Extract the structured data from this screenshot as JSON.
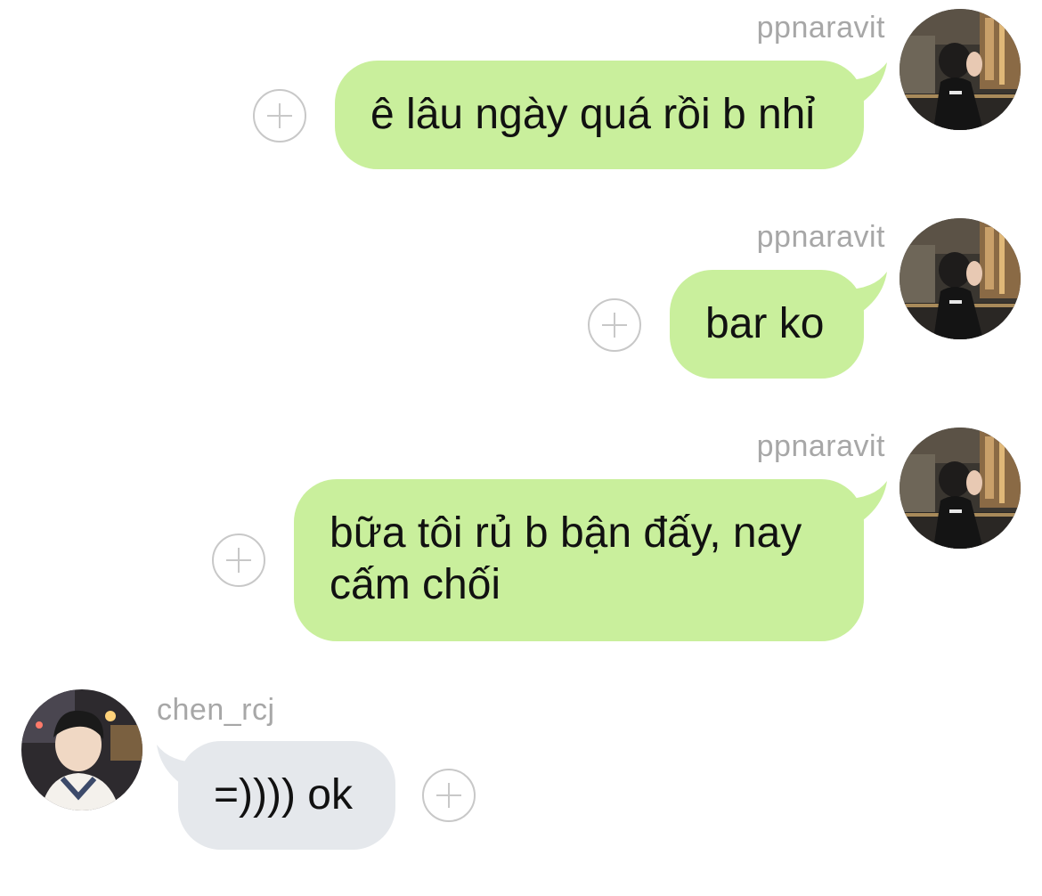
{
  "colors": {
    "outgoing_bubble": "#c9ef9c",
    "incoming_bubble": "#e5e8ec",
    "username_text": "#a7a7a7",
    "icon_gray": "#c8c8c8"
  },
  "messages": [
    {
      "direction": "outgoing",
      "username": "ppnaravit",
      "text": "ê lâu ngày quá rồi b nhỉ",
      "avatar_icon": "user-avatar-icon",
      "action_icon": "add-reaction-icon"
    },
    {
      "direction": "outgoing",
      "username": "ppnaravit",
      "text": "bar ko",
      "avatar_icon": "user-avatar-icon",
      "action_icon": "add-reaction-icon"
    },
    {
      "direction": "outgoing",
      "username": "ppnaravit",
      "text_lines": [
        "bữa tôi rủ b bận đấy, nay",
        "cấm chối"
      ],
      "avatar_icon": "user-avatar-icon",
      "action_icon": "add-reaction-icon"
    },
    {
      "direction": "incoming",
      "username": "chen_rcj",
      "text": "=)))) ok",
      "avatar_icon": "user-avatar-icon",
      "action_icon": "add-reaction-icon"
    }
  ]
}
